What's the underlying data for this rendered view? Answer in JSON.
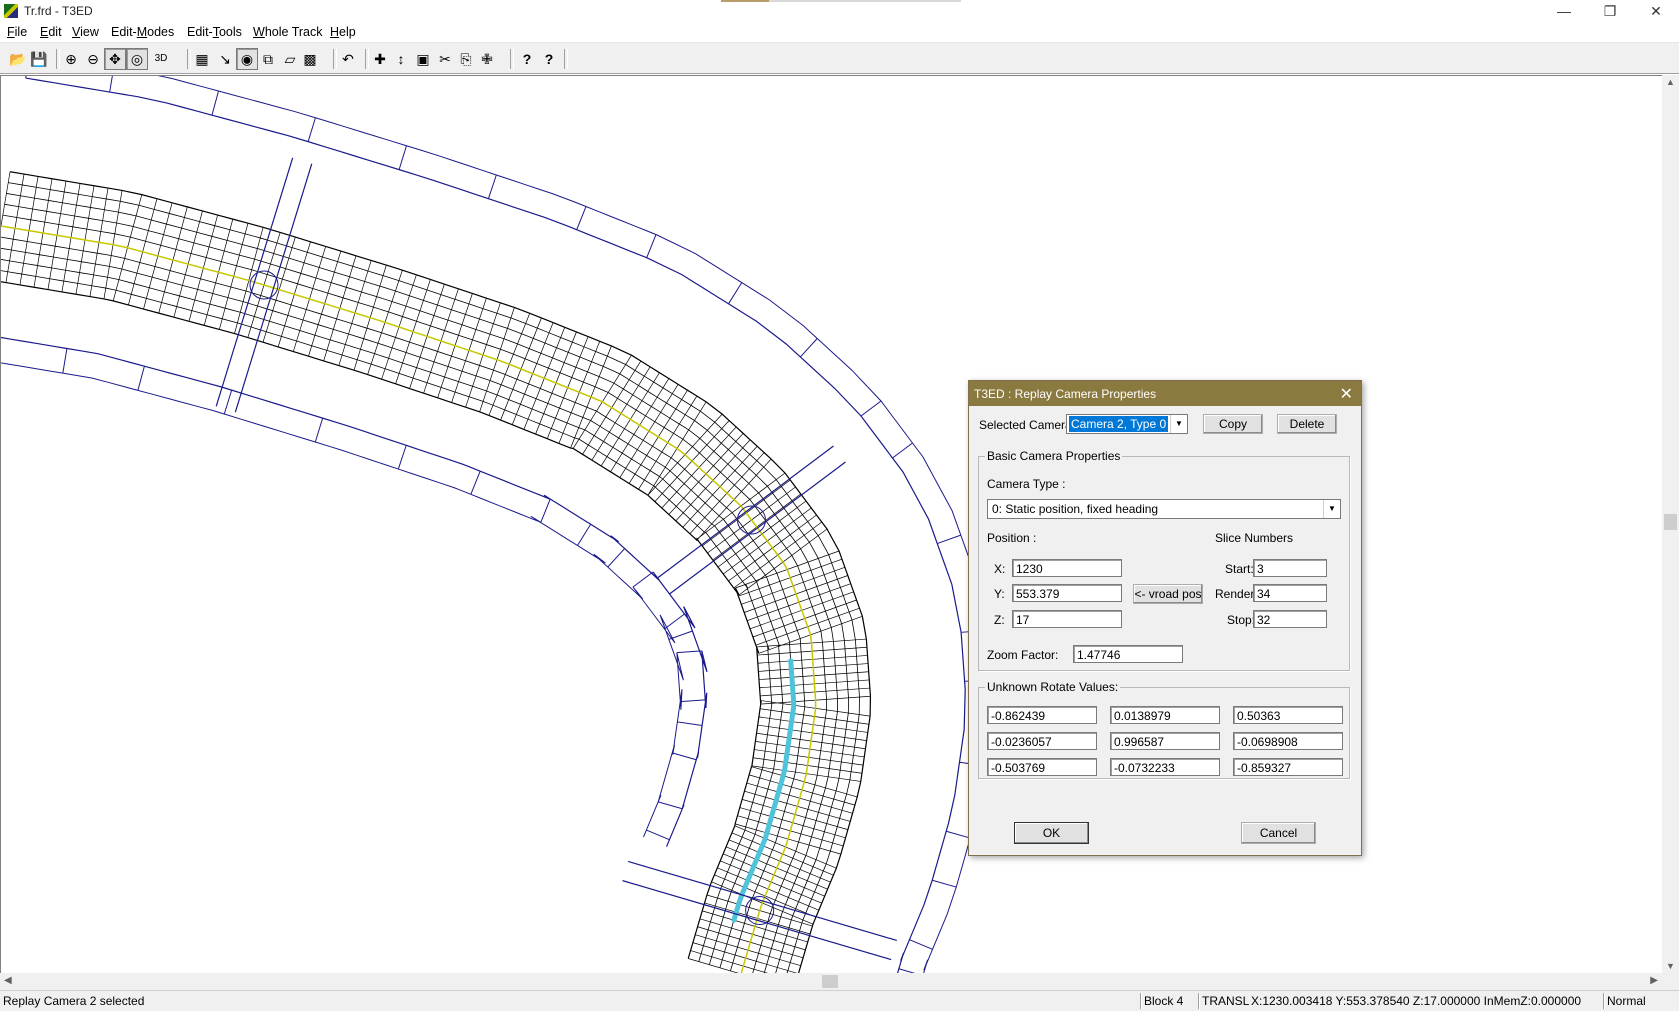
{
  "window": {
    "title": "Tr.frd - T3ED",
    "controls": {
      "minimize": "—",
      "restore": "❐",
      "close": "✕"
    }
  },
  "menu": [
    {
      "pre": "",
      "u": "F",
      "post": "ile"
    },
    {
      "pre": "",
      "u": "E",
      "post": "dit"
    },
    {
      "pre": "",
      "u": "V",
      "post": "iew"
    },
    {
      "pre": "Edit-",
      "u": "M",
      "post": "odes"
    },
    {
      "pre": "Edit-",
      "u": "T",
      "post": "ools"
    },
    {
      "pre": "",
      "u": "W",
      "post": "hole Track"
    },
    {
      "pre": "",
      "u": "H",
      "post": "elp"
    }
  ],
  "toolbar": {
    "icons": [
      "open-icon",
      "save-icon",
      "zoom-in-icon",
      "zoom-out-icon",
      "move-icon",
      "rotate-view-icon",
      "3d-view-icon",
      "track-mesh-icon",
      "point-edit-icon",
      "block-select-icon",
      "object-box-icon",
      "polygon-icon",
      "texture-grid-icon",
      "undo-icon",
      "translate-icon",
      "vertical-move-icon",
      "picture-icon",
      "cut-icon",
      "copy-icon",
      "paste-icon",
      "help-icon",
      "context-help-icon"
    ],
    "glyphs": [
      "📂",
      "💾",
      "⊕",
      "⊖",
      "✥",
      "◎",
      "3D",
      "▦",
      "↘",
      "◉",
      "⧉",
      "▱",
      "▩",
      "↶",
      "✚",
      "↕",
      "▣",
      "✂",
      "⎘",
      "✙",
      "?",
      "?"
    ]
  },
  "dialog": {
    "title": "T3ED : Replay Camera Properties",
    "close": "✕",
    "selected_camera_label": "Selected Camera:",
    "selected_camera_value": "Camera 2, Type 0",
    "copy_label": "Copy",
    "delete_label": "Delete",
    "basic_group": "Basic Camera Properties",
    "camera_type_label": "Camera Type :",
    "camera_type_value": "0: Static position, fixed heading",
    "position_label": "Position :",
    "x_label": "X:",
    "x_value": "1230",
    "y_label": "Y:",
    "y_value": "553.379",
    "z_label": "Z:",
    "z_value": "17",
    "vroad_label": "<- vroad pos",
    "slice_label": "Slice Numbers",
    "start_label": "Start:",
    "start_value": "3",
    "render_label": "Render:",
    "render_value": "34",
    "stop_label": "Stop:",
    "stop_value": "32",
    "zoom_label": "Zoom Factor:",
    "zoom_value": "1.47746",
    "rotate_group": "Unknown Rotate Values:",
    "rotate": [
      [
        "-0.862439",
        "0.0138979",
        "0.50363"
      ],
      [
        "-0.0236057",
        "0.996587",
        "-0.0698908"
      ],
      [
        "-0.503769",
        "-0.0732233",
        "-0.859327"
      ]
    ],
    "ok_label": "OK",
    "cancel_label": "Cancel"
  },
  "status": {
    "message": "Replay Camera 2 selected",
    "block": "Block 4",
    "mode": "TRANSL",
    "coords": "X:1230.003418 Y:553.378540 Z:17.000000 InMemZ:0.000000",
    "view": "Normal"
  },
  "colors": {
    "caption": "#8b7a3f",
    "mesh": "#000000",
    "objects": "#1a1a8c",
    "route": "#4fc3d9",
    "centerline": "#c8c800"
  }
}
